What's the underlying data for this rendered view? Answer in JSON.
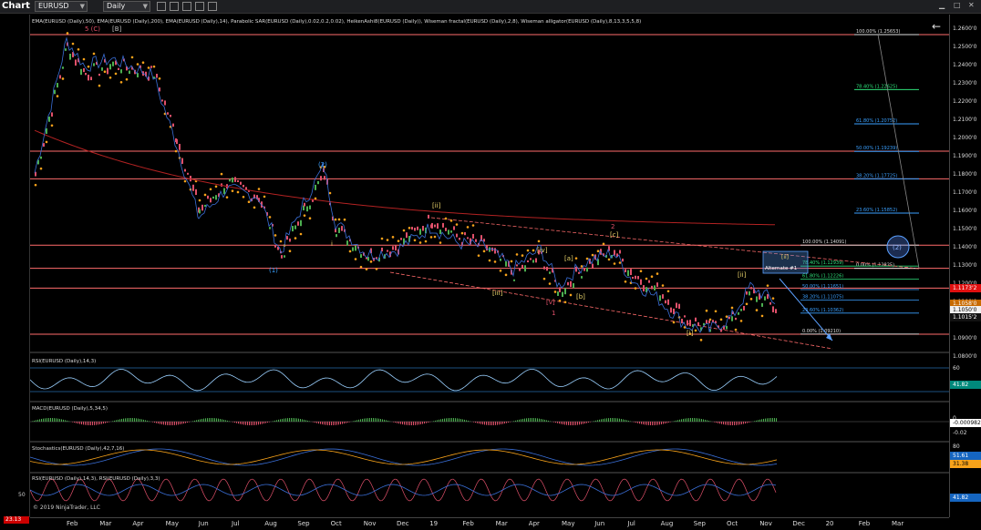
{
  "toolbar": {
    "title": "Chart",
    "instrument": "EURUSD",
    "period": "Daily"
  },
  "header": {
    "indicators": "EMA(EURUSD (Daily),50), EMA(EURUSD (Daily),200), EMA(EURUSD (Daily),14), Parabolic SAR(EURUSD (Daily),0.02,0.2,0.02), HeikenAshi8(EURUSD (Daily)), Wiseman fractal(EURUSD (Daily),2,8), Wiseman alligator(EURUSD (Daily),8,13,3,5,5,8)"
  },
  "yaxis": {
    "ticks": [
      "1.2600'0",
      "1.2500'0",
      "1.2400'0",
      "1.2300'0",
      "1.2200'0",
      "1.2100'0",
      "1.2000'0",
      "1.1900'0",
      "1.1800'0",
      "1.1700'0",
      "1.1600'0",
      "1.1500'0",
      "1.1400'0",
      "1.1300'0",
      "1.1200'0",
      "1.1100'0",
      "1.1000'0",
      "1.0900'0",
      "1.0800'0"
    ],
    "price_current": "1.1015'2",
    "price_red": "1.1173'2",
    "price_orange": "1.1058'0",
    "price_white": "1.1050'0"
  },
  "xaxis": {
    "ticks": [
      "Feb",
      "Mar",
      "Apr",
      "May",
      "Jun",
      "Jul",
      "Aug",
      "Sep",
      "Oct",
      "Nov",
      "Dec",
      "19",
      "Feb",
      "Mar",
      "Apr",
      "May",
      "Jun",
      "Jul",
      "Aug",
      "Sep",
      "Oct",
      "Nov",
      "Dec",
      "20",
      "Feb",
      "Mar"
    ]
  },
  "fib_upper": [
    {
      "label": "100.00% (1.25653)",
      "color": "#dddddd"
    },
    {
      "label": "78.40% (1.22625)",
      "color": "#2ee07a"
    },
    {
      "label": "61.80% (1.20752)",
      "color": "#3aa0ff"
    },
    {
      "label": "50.00% (1.19239)",
      "color": "#3aa0ff"
    },
    {
      "label": "38.20% (1.17725)",
      "color": "#3aa0ff"
    },
    {
      "label": "23.60% (1.15852)",
      "color": "#3aa0ff"
    },
    {
      "label": "0.00% (1.12825)",
      "color": "#dddddd"
    }
  ],
  "fib_lower": [
    {
      "label": "100.00% (1.14091)",
      "color": "#dddddd"
    },
    {
      "label": "78.40% (1.12939)",
      "color": "#2ee07a"
    },
    {
      "label": "61.80% (1.12226)",
      "color": "#2ee07a"
    },
    {
      "label": "50.00% (1.11651)",
      "color": "#3aa0ff"
    },
    {
      "label": "38.20% (1.11075)",
      "color": "#3aa0ff"
    },
    {
      "label": "23.60% (1.10362)",
      "color": "#3aa0ff"
    },
    {
      "label": "0.00% (1.09210)",
      "color": "#dddddd"
    }
  ],
  "waves": {
    "w5c": "5 (C)",
    "wB": "[B]",
    "w2": "(2)",
    "w1": "(1)",
    "wi": "i",
    "wii_a": "[ii]",
    "wiii": "[iii]",
    "wiv": "[iv]",
    "wa": "[a]",
    "wb": "[b]",
    "wv": "[v]",
    "w1r": "1",
    "w2r": "2",
    "wc": "[c]",
    "wi_b": "[i]",
    "wii_b": "[ii]",
    "wii_box": "[ii]",
    "alt": "Alternate #1",
    "circle2": "(2)"
  },
  "panels": {
    "rsi": {
      "title": "RSI(EURUSD (Daily),14,3)",
      "t60": "60",
      "t40": "40",
      "value": "41.82"
    },
    "macd": {
      "title": "MACD(EURUSD (Daily),5,34,5)",
      "t0": "0",
      "tneg": "-0.02",
      "value": "-0.000982"
    },
    "stoch": {
      "title": "Stochastics(EURUSD (Daily),42,7,16)",
      "t80": "80",
      "t20": "20",
      "v1": "51.61",
      "v2": "31.38"
    },
    "rsi2": {
      "title": "RSI(EURUSD (Daily),14,3), RSI(EURUSD (Daily),3,3)",
      "t50": "50",
      "value": "41.82",
      "badge": "23.13"
    }
  },
  "copyright": "© 2019 NinjaTrader, LLC",
  "colors": {
    "up": "#4caf50",
    "down": "#e0506a",
    "sar": "#f7a21a",
    "resistance": "#ff6b6b",
    "ema200": "#b22222",
    "ema50": "#3a6fd8"
  }
}
